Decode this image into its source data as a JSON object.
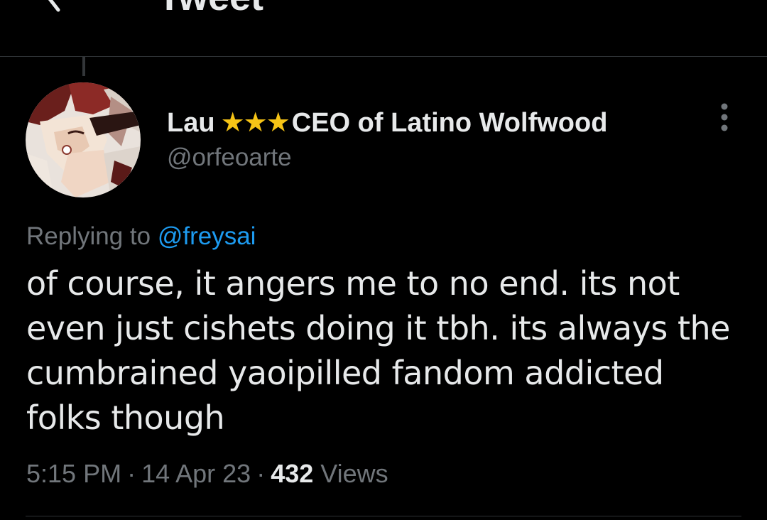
{
  "header": {
    "title": "Tweet",
    "back_icon": "arrow-left-icon"
  },
  "tweet": {
    "author": {
      "name_prefix": "Lau",
      "name_stars": "★★★",
      "name_suffix": "CEO of Latino Wolfwood",
      "handle": "@orfeoarte",
      "avatar_icon": "user-avatar"
    },
    "reply_label": "Replying to",
    "reply_mention": "@freysai",
    "text": "of course, it angers me to no end. its not even just cishets doing it tbh. its always the cumbrained yaoipilled fandom addicted folks though",
    "time": "5:15 PM",
    "date": "14 Apr 23",
    "separator": "·",
    "views_count": "432",
    "views_label": "Views",
    "more_icon": "more-vertical-icon"
  },
  "colors": {
    "background": "#000000",
    "text_primary": "#e7e9ea",
    "text_secondary": "#71767b",
    "link": "#1d9bf0",
    "stars": "#f6c416",
    "divider": "#2f3336"
  }
}
